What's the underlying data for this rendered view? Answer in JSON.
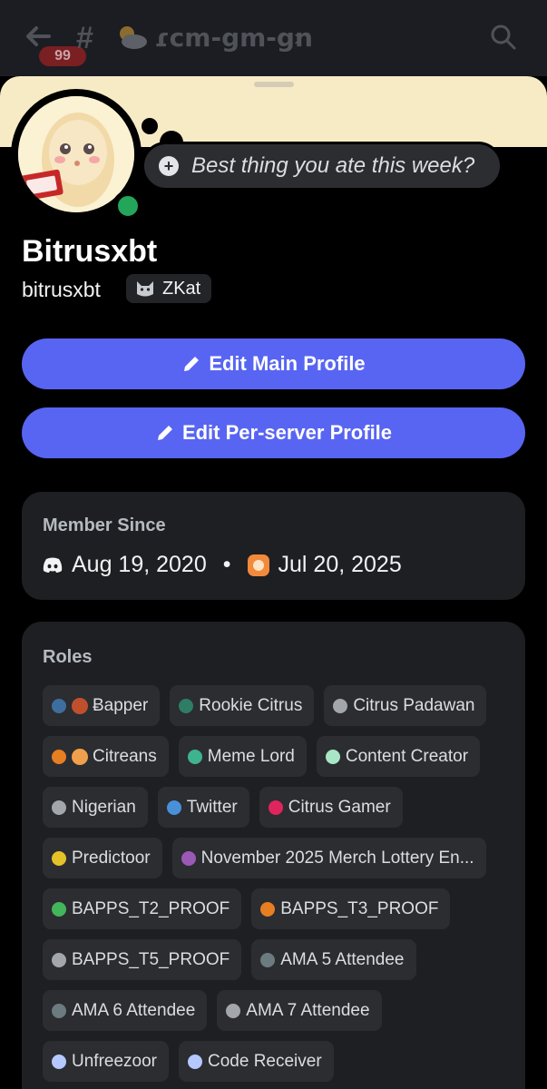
{
  "topbar": {
    "unread_badge": "99",
    "channel_name": "ɾcm-gm-gn",
    "icons": [
      "back-arrow-icon",
      "hash-icon",
      "cloud-icon",
      "chevron-right-icon",
      "search-icon"
    ]
  },
  "profile": {
    "custom_status": "Best thing you ate this week?",
    "display_name": "Bitrusxbt",
    "username": "bitrusxbt",
    "guild_tag": "ZKat",
    "status": "online",
    "colors": {
      "banner": "#f7ebc6",
      "accent_button": "#5865f2",
      "online": "#23a55a"
    }
  },
  "buttons": {
    "edit_main": "Edit Main Profile",
    "edit_server": "Edit Per-server Profile"
  },
  "member_since": {
    "title": "Member Since",
    "discord_date": "Aug 19, 2020",
    "separator": "•",
    "server_date": "Jul 20, 2025"
  },
  "roles": {
    "title": "Roles",
    "items": [
      {
        "name": "Ƀapper",
        "color": "#3e6e9f",
        "emoji": true
      },
      {
        "name": "Rookie Citrus",
        "color": "#2e7d64"
      },
      {
        "name": "Citrus Padawan",
        "color": "#a3a6aa"
      },
      {
        "name": "Citreans",
        "color": "#e67e22",
        "emoji": true
      },
      {
        "name": "Meme Lord",
        "color": "#3fb38e"
      },
      {
        "name": "Content Creator",
        "color": "#a8e6c6"
      },
      {
        "name": "Nigerian",
        "color": "#a3a6aa"
      },
      {
        "name": "Twitter",
        "color": "#4a90d9"
      },
      {
        "name": "Citrus Gamer",
        "color": "#e0245e"
      },
      {
        "name": "Predictoor",
        "color": "#e6c229"
      },
      {
        "name": "November 2025 Merch Lottery En...",
        "color": "#9b59b6"
      },
      {
        "name": "BAPPS_T2_PROOF",
        "color": "#43b55a"
      },
      {
        "name": "BAPPS_T3_PROOF",
        "color": "#e67e22"
      },
      {
        "name": "BAPPS_T5_PROOF",
        "color": "#a3a6aa"
      },
      {
        "name": "AMA 5 Attendee",
        "color": "#6b7b80"
      },
      {
        "name": "AMA 6 Attendee",
        "color": "#6b7b80"
      },
      {
        "name": "AMA 7 Attendee",
        "color": "#a3a6aa"
      },
      {
        "name": "Unfreezoor",
        "color": "#b5c8ff"
      },
      {
        "name": "Code Receiver",
        "color": "#b5c8ff"
      }
    ]
  }
}
